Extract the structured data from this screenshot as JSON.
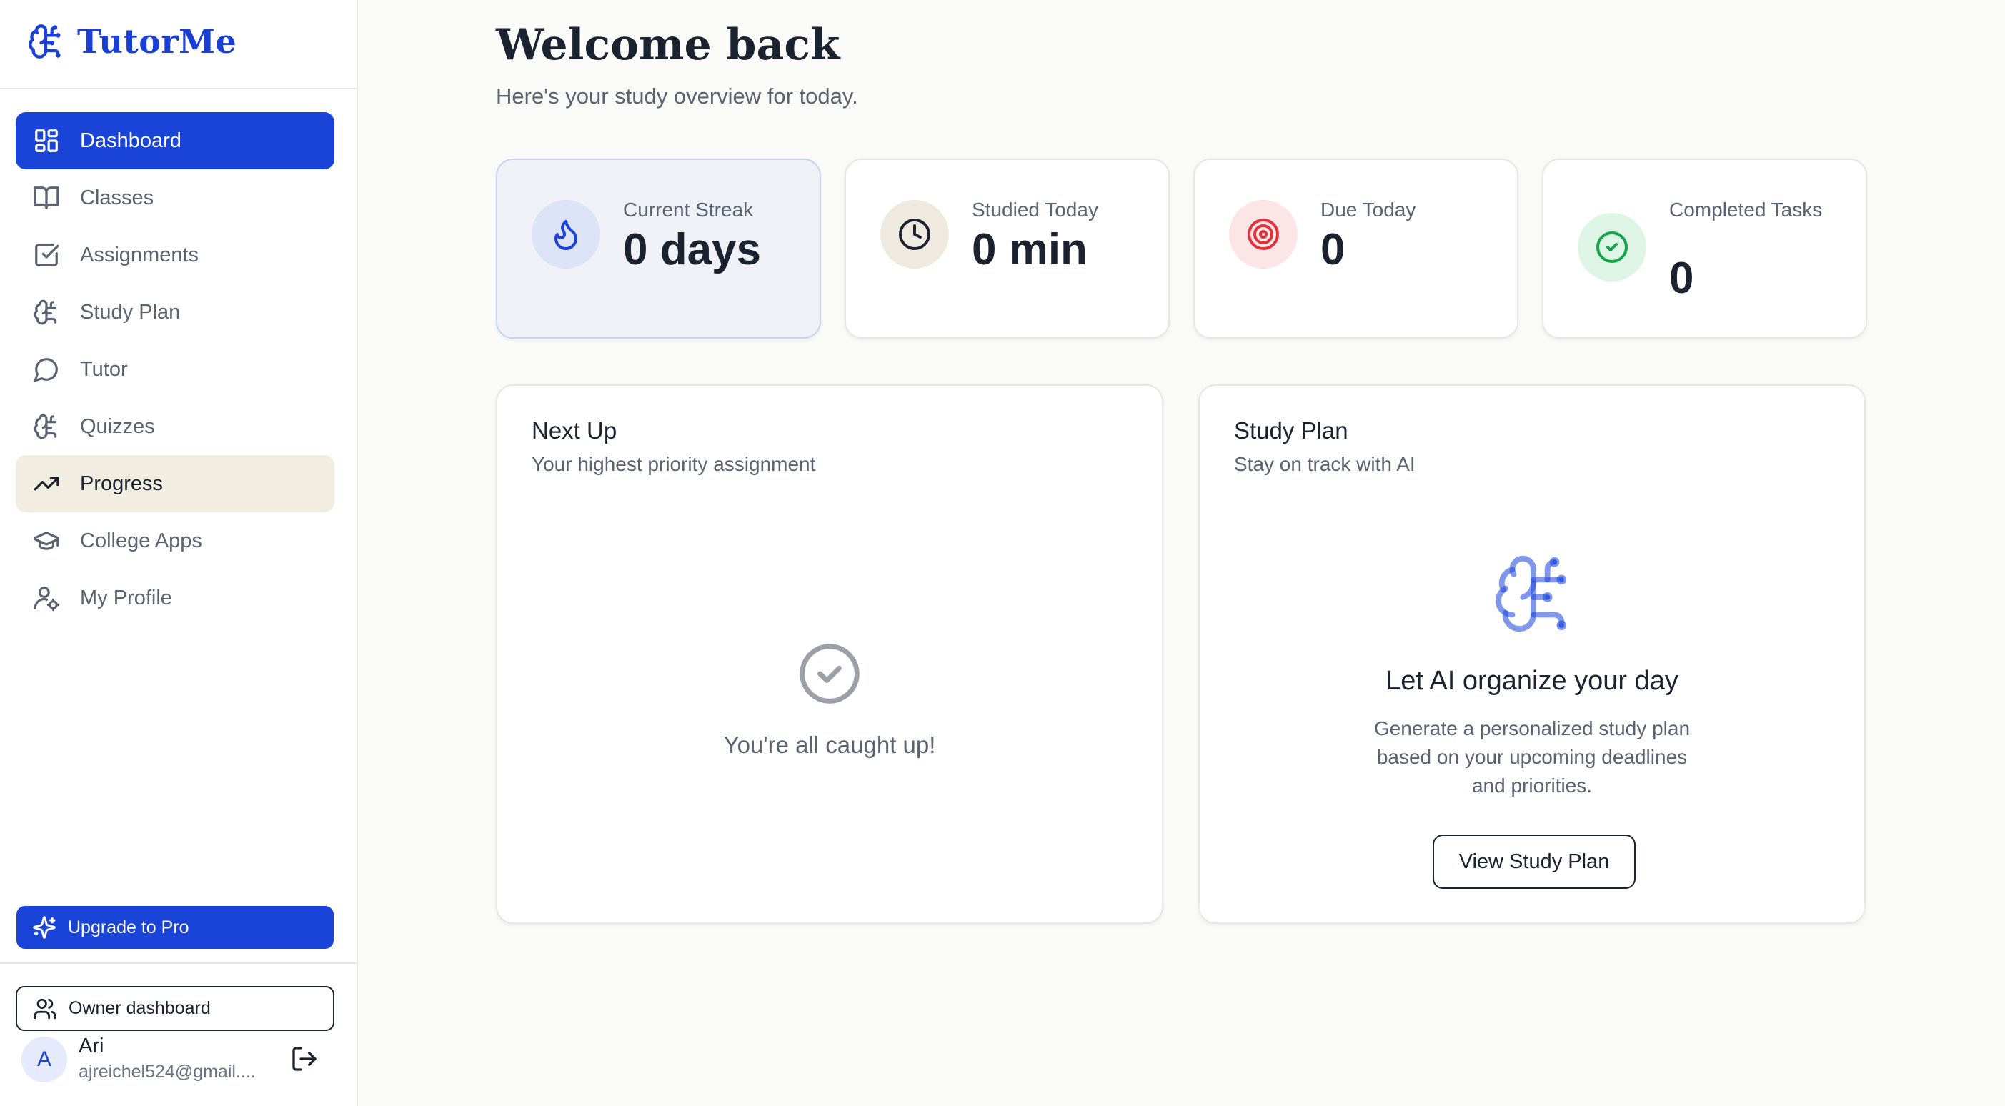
{
  "brand": {
    "name": "TutorMe",
    "icon": "brain-circuit-icon",
    "color": "#1a3fd4"
  },
  "sidebar": {
    "items": [
      {
        "label": "Dashboard",
        "icon": "layout-grid-icon",
        "state": "active"
      },
      {
        "label": "Classes",
        "icon": "book-open-icon",
        "state": ""
      },
      {
        "label": "Assignments",
        "icon": "check-square-icon",
        "state": ""
      },
      {
        "label": "Study Plan",
        "icon": "brain-circuit-icon",
        "state": ""
      },
      {
        "label": "Tutor",
        "icon": "chat-bubble-icon",
        "state": ""
      },
      {
        "label": "Quizzes",
        "icon": "brain-circuit-icon",
        "state": ""
      },
      {
        "label": "Progress",
        "icon": "trending-up-icon",
        "state": "hover"
      },
      {
        "label": "College Apps",
        "icon": "graduation-cap-icon",
        "state": ""
      },
      {
        "label": "My Profile",
        "icon": "user-cog-icon",
        "state": ""
      }
    ],
    "upgrade_label": "Upgrade to Pro",
    "owner_label": "Owner dashboard",
    "user": {
      "initial": "A",
      "name": "Ari",
      "email": "ajreichel524@gmail...."
    }
  },
  "main": {
    "title": "Welcome back",
    "subtitle": "Here's your study overview for today.",
    "stats": [
      {
        "label": "Current Streak",
        "value": "0 days",
        "icon": "flame-icon",
        "accent": "#1a43d8"
      },
      {
        "label": "Studied Today",
        "value": "0 min",
        "icon": "clock-icon",
        "accent": "#1c2330"
      },
      {
        "label": "Due Today",
        "value": "0",
        "icon": "target-icon",
        "accent": "#e0323c"
      },
      {
        "label": "Completed Tasks",
        "value": "0",
        "icon": "check-circle-icon",
        "accent": "#16a34a"
      }
    ],
    "next_up": {
      "title": "Next Up",
      "subtitle": "Your highest priority assignment",
      "empty_text": "You're all caught up!"
    },
    "study_plan": {
      "title": "Study Plan",
      "subtitle": "Stay on track with AI",
      "heading": "Let AI organize your day",
      "description": "Generate a personalized study plan based on your upcoming deadlines and priorities.",
      "button_label": "View Study Plan"
    }
  },
  "colors": {
    "primary": "#1a43d8",
    "hover_bg": "#f1ede1",
    "background": "#fafaf9"
  }
}
